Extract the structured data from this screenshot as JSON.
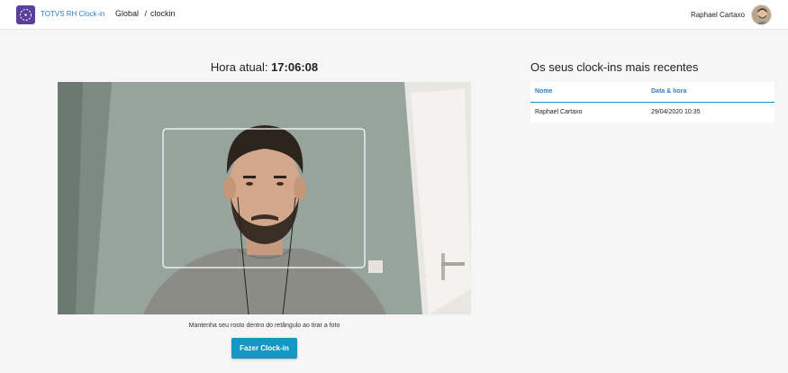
{
  "topbar": {
    "app_title": "TOTVS RH Clock-in",
    "breadcrumb": {
      "first": "Global",
      "separator": "/",
      "second": "clockin"
    },
    "user_name": "Raphael Cartaxo"
  },
  "clock": {
    "label": "Hora atual:",
    "time": "17:06:08"
  },
  "camera": {
    "hint": "Mantenha seu rosto dentro do retângulo ao tirar a foto"
  },
  "actions": {
    "clockin_label": "Fazer Clock-in"
  },
  "recent": {
    "title": "Os seus clock-ins mais recentes",
    "columns": [
      "Nome",
      "Data & hora"
    ],
    "rows": [
      {
        "name": "Raphael Cartaxo",
        "datetime": "29/04/2020 10:35"
      }
    ]
  },
  "icons": {
    "logo": "app-logo-icon",
    "avatar": "user-avatar"
  },
  "colors": {
    "accent": "#1597c4",
    "link": "#2f7fc0",
    "brand": "#5b3f9c"
  }
}
